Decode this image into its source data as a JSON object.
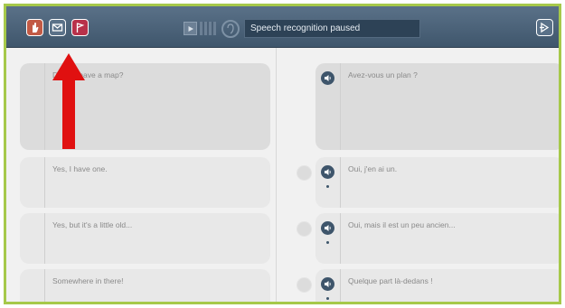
{
  "toolbar": {
    "buttons": [
      {
        "icon": "cursor-hand-icon",
        "color": "#c25a45"
      },
      {
        "icon": "envelope-icon",
        "color": "#5a7188"
      },
      {
        "icon": "flag-icon",
        "color": "#b8314a"
      }
    ],
    "status_text": "Speech recognition paused",
    "next_icon": "next-arrow-icon"
  },
  "dialogue": [
    {
      "source": "Do you have a map?",
      "target": "Avez-vous un plan ?"
    },
    {
      "source": "Yes, I have one.",
      "target": "Oui, j'en ai un."
    },
    {
      "source": "Yes, but it's a little old...",
      "target": "Oui, mais il est un peu ancien..."
    },
    {
      "source": "Somewhere in there!",
      "target": "Quelque part là-dedans !"
    }
  ],
  "annotation": {
    "type": "red-arrow",
    "color": "#e01010"
  }
}
